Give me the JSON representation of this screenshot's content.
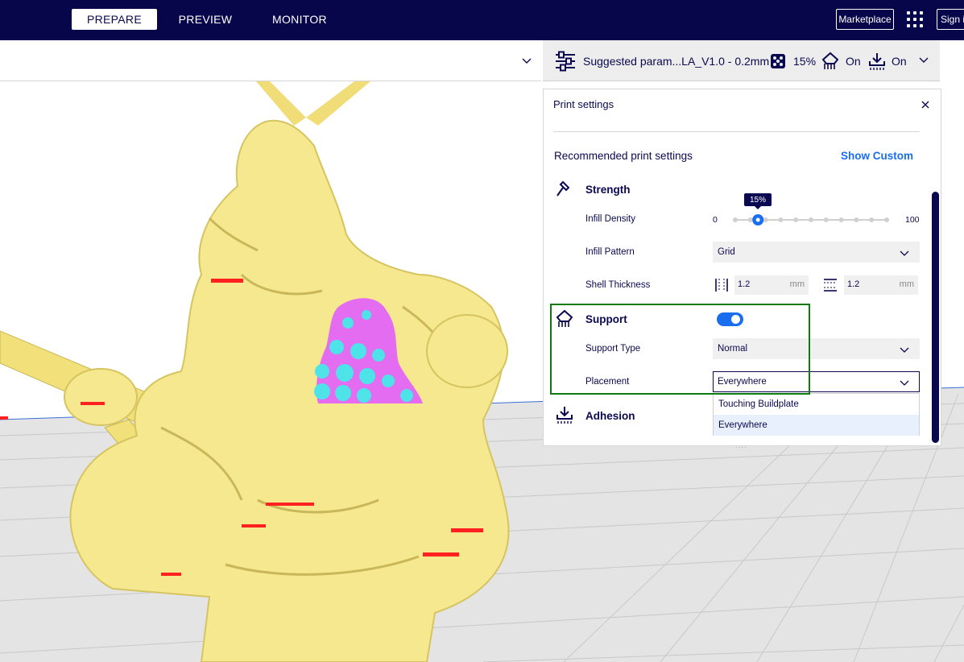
{
  "topbar": {
    "tabs": [
      {
        "label": "PREPARE",
        "active": true
      },
      {
        "label": "PREVIEW",
        "active": false
      },
      {
        "label": "MONITOR",
        "active": false
      }
    ],
    "marketplace_label": "Marketplace",
    "signin_label": "Sign in"
  },
  "printbar": {
    "profile_label": "Suggested param...LA_V1.0 - 0.2mm",
    "infill_value": "15%",
    "support_value": "On",
    "adhesion_value": "On"
  },
  "panel": {
    "title": "Print settings",
    "recommended_title": "Recommended print settings",
    "show_custom_label": "Show Custom",
    "strength": {
      "title": "Strength",
      "infill_density_label": "Infill Density",
      "infill_min": "0",
      "infill_max": "100",
      "infill_value": "15%",
      "infill_fraction": 0.15,
      "infill_pattern_label": "Infill Pattern",
      "infill_pattern_value": "Grid",
      "shell_thickness_label": "Shell Thickness",
      "wall_thickness": "1.2",
      "topbottom_thickness": "1.2",
      "unit": "mm"
    },
    "support": {
      "title": "Support",
      "enabled": true,
      "support_type_label": "Support Type",
      "support_type_value": "Normal",
      "placement_label": "Placement",
      "placement_value": "Everywhere",
      "placement_options": [
        "Touching Buildplate",
        "Everywhere"
      ]
    },
    "adhesion": {
      "title": "Adhesion"
    }
  },
  "colors": {
    "navy": "#07064b",
    "accent_blue": "#196ef0",
    "highlight_green": "#0d7a12",
    "model_yellow": "#f6e88f",
    "overhang_red": "#ff0000",
    "support_magenta": "#e36cf0",
    "support_cyan": "#4de3e8"
  },
  "icons": [
    "settings-sliders-icon",
    "infill-icon",
    "support-icon",
    "adhesion-icon",
    "chevron-down-icon",
    "close-icon",
    "apps-grid-icon",
    "strength-hammer-icon"
  ]
}
